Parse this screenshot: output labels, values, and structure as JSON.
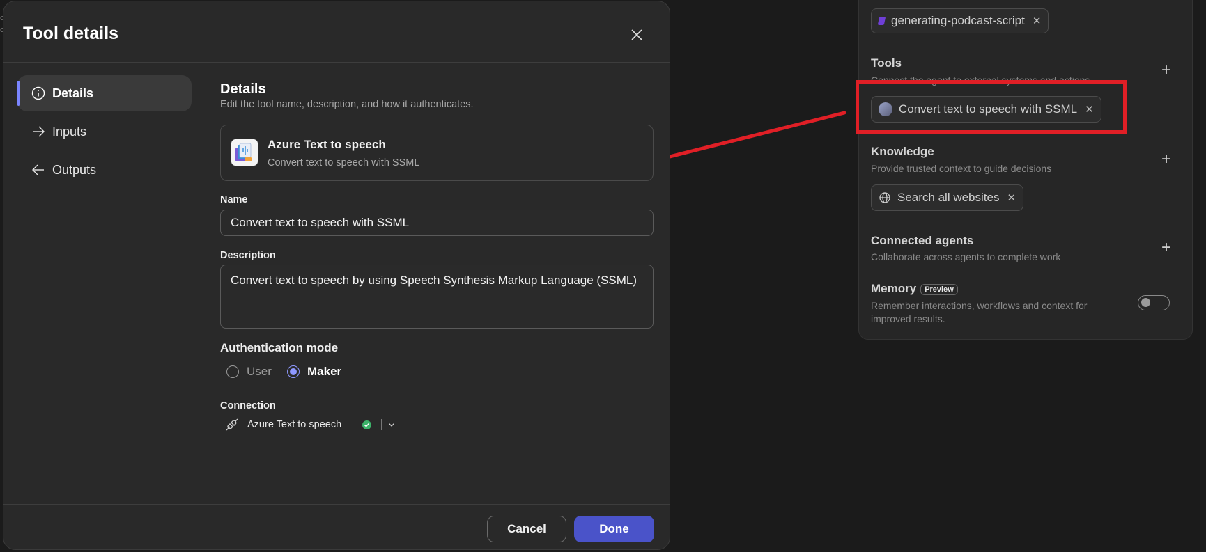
{
  "edge": {
    "line1": "c",
    "line2": "c"
  },
  "background_panel": {
    "instructions_chip": {
      "label": "generating-podcast-script"
    },
    "tools": {
      "title": "Tools",
      "subtitle": "Connect the agent to external systems and actions",
      "chip_label": "Convert text to speech with SSML"
    },
    "knowledge": {
      "title": "Knowledge",
      "subtitle": "Provide trusted context to guide decisions",
      "chip_label": "Search all websites"
    },
    "connected_agents": {
      "title": "Connected agents",
      "subtitle": "Collaborate across agents to complete work"
    },
    "memory": {
      "title": "Memory",
      "badge": "Preview",
      "subtitle": "Remember interactions, workflows and context for improved results.",
      "toggle_on": false
    }
  },
  "dialog": {
    "title": "Tool details",
    "nav": [
      {
        "label": "Details",
        "icon": "info-icon",
        "active": true
      },
      {
        "label": "Inputs",
        "icon": "arrow-right-icon",
        "active": false
      },
      {
        "label": "Outputs",
        "icon": "arrow-left-icon",
        "active": false
      }
    ],
    "details": {
      "title": "Details",
      "subtitle": "Edit the tool name, description, and how it authenticates.",
      "tool_card": {
        "name": "Azure Text to speech",
        "description": "Convert text to speech with SSML"
      },
      "name_label": "Name",
      "name_value": "Convert text to speech with SSML",
      "description_label": "Description",
      "description_value": "Convert text to speech by using Speech Synthesis Markup Language (SSML)",
      "auth_title": "Authentication mode",
      "auth_options": [
        {
          "label": "User",
          "selected": false
        },
        {
          "label": "Maker",
          "selected": true
        }
      ],
      "connection_label": "Connection",
      "connection_value": "Azure Text to speech",
      "connection_status": "connected"
    },
    "footer": {
      "cancel": "Cancel",
      "done": "Done"
    }
  },
  "colors": {
    "accent": "#4a53c9",
    "annotation_red": "#e01f26",
    "status_green": "#3db36a"
  }
}
